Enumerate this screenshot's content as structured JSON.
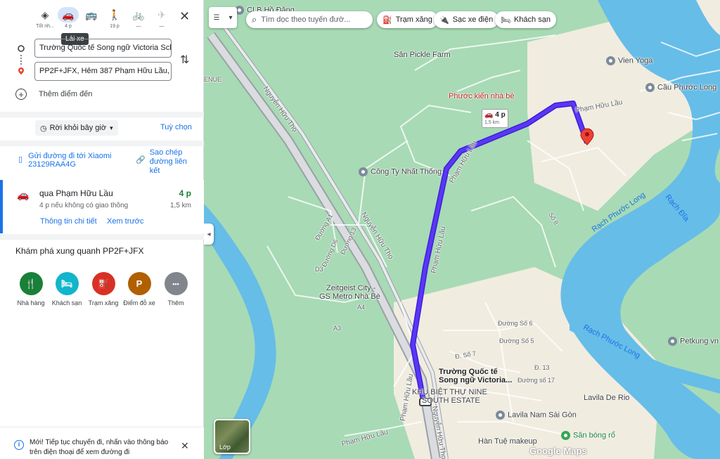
{
  "modes": [
    {
      "icon": "best-route-icon",
      "glyph": "◈",
      "label": "Tốt nh..."
    },
    {
      "icon": "car-icon",
      "glyph": "🚗",
      "label": "4 p"
    },
    {
      "icon": "bus-icon",
      "glyph": "🚌",
      "label": ""
    },
    {
      "icon": "walk-icon",
      "glyph": "🚶",
      "label": "19 p"
    },
    {
      "icon": "bike-icon",
      "glyph": "🚲",
      "label": "—"
    },
    {
      "icon": "plane-icon",
      "glyph": "✈",
      "label": "—"
    }
  ],
  "tooltip": "Lái xe",
  "origin_value": "Trường Quốc tế Song ngữ Victoria Schoo",
  "destination_value": "PP2F+JFX, Hẻm 387 Phạm Hữu Lầu, Nhà",
  "add_destination": "Thêm điểm đến",
  "depart_label": "Rời khỏi bây giờ",
  "options_label": "Tuỳ chọn",
  "send_to_phone": "Gửi đường đi tới Xiaomi 23129RAA4G",
  "copy_link": "Sao chép đường liên kết",
  "route": {
    "name": "qua Phạm Hữu Lầu",
    "duration": "4 p",
    "subtitle": "4 p nếu không có giao thông",
    "distance": "1,5 km",
    "details_link": "Thông tin chi tiết",
    "preview_link": "Xem trước"
  },
  "explore_title": "Khám phá xung quanh PP2F+JFX",
  "categories": [
    {
      "label": "Nhà hàng",
      "color": "#188038",
      "glyph": "🍴"
    },
    {
      "label": "Khách sạn",
      "color": "#12b5cb",
      "glyph": "🛏"
    },
    {
      "label": "Trạm xăng",
      "color": "#d93025",
      "glyph": "⛽"
    },
    {
      "label": "Điểm đỗ xe",
      "color": "#b06000",
      "glyph": "P"
    },
    {
      "label": "Thêm",
      "color": "#80868b",
      "glyph": "•••"
    }
  ],
  "notice": "Mới! Tiếp tục chuyến đi, nhấn vào thông báo trên điện thoại để xem đường đi",
  "map": {
    "search_placeholder": "Tìm dọc theo tuyến đườ...",
    "chips": [
      "Trạm xăng",
      "Sạc xe điện",
      "Khách sạn"
    ],
    "layer_label": "Lớp",
    "brand": "Google Maps",
    "route_time": "4 p",
    "route_dist": "1,5 km",
    "labels": {
      "clb": "CLB Hồ Đăng",
      "pickle": "Sân Pickle Farm",
      "phuoc_kien": "Phước kiển nhà bè",
      "vien_yoga": "Vien Yoga",
      "cau_phuoc_long": "Cầu Phước Long",
      "pham_huu_lau_top": "Phạm Hữu Lầu",
      "cong_ty": "Công Ty Nhất Thống",
      "zeitgeist_1": "Zeitgeist City -",
      "zeitgeist_2": "GS Metro Nhà Bè",
      "truong_1": "Trường Quốc tế",
      "truong_2": "Song ngữ Victoria...",
      "khu_biet_thu_1": "KHU BIỆT THỰ NINE",
      "khu_biet_thu_2": "SOUTH ESTATE",
      "lavila_ns": "Lavila Nam Sài Gòn",
      "lavila_rio": "Lavila De Rio",
      "han_tue": "Hàn Tuệ makeup",
      "san_bong": "Sân bóng rổ",
      "petkung": "Petkung vn",
      "rach_phuoc_long": "Rạch Phước Long",
      "rach_phuoc_long_2": "Rạch Phước Long",
      "rach_dia": "Rạch Đĩa",
      "nguyen_huu_tho_1": "Nguyễn Hữu Thọ",
      "nguyen_huu_tho_2": "Nguyễn Hữu Thọ",
      "nguyen_huu_tho_3": "Nguyễn Hữu Thọ",
      "pham_huu_lau_mid": "Phạm Hữu Lầu",
      "pham_huu_lau_low": "Phạm Hữu Lầu",
      "pham_huu_lau_bottom": "Phạm Hữu Lầu",
      "pham_huu_lau_left": "Phạm Hữu Lầu",
      "enue": "ENUE",
      "duong_a1": "Đường A1",
      "duong_d6": "Đường D6",
      "duong_13": "Đường 13",
      "d3": "D3",
      "a4": "A4",
      "a3": "A3",
      "so7": "Đ. Số 7",
      "so5": "Đường Số 5",
      "so6": "Đường Số 6",
      "so17": "Đường số 17",
      "so8": "Số 8",
      "d13": "Đ. 13"
    }
  }
}
